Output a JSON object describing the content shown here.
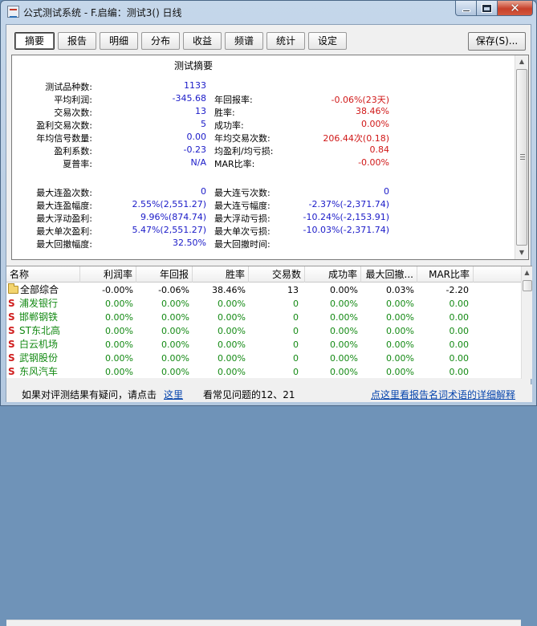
{
  "window": {
    "title": "公式测试系统 - F.启编：测试3() 日线",
    "controls": {
      "minimize": "minimize-icon",
      "maximize": "maximize-icon",
      "close": "close-icon"
    }
  },
  "tabs": [
    {
      "label": "摘要",
      "active": true
    },
    {
      "label": "报告"
    },
    {
      "label": "明细"
    },
    {
      "label": "分布"
    },
    {
      "label": "收益"
    },
    {
      "label": "频谱"
    },
    {
      "label": "统计"
    },
    {
      "label": "设定"
    }
  ],
  "save_label": "保存(S)...",
  "summary": {
    "title": "测试摘要",
    "rows": [
      {
        "l1": "测试品种数:",
        "v1": "1133",
        "c1": "blue",
        "l2": "",
        "v2": "",
        "c2": ""
      },
      {
        "l1": "平均利润:",
        "v1": "-345.68",
        "c1": "blue",
        "l2": "年回报率:",
        "v2": "-0.06%(23天)",
        "c2": "red"
      },
      {
        "l1": "交易次数:",
        "v1": "13",
        "c1": "blue",
        "l2": "胜率:",
        "v2": "38.46%",
        "c2": "red"
      },
      {
        "l1": "盈利交易次数:",
        "v1": "5",
        "c1": "blue",
        "l2": "成功率:",
        "v2": "0.00%",
        "c2": "red"
      },
      {
        "l1": "年均信号数量:",
        "v1": "0.00",
        "c1": "blue",
        "l2": "年均交易次数:",
        "v2": "206.44次(0.18)",
        "c2": "red"
      },
      {
        "l1": "盈利系数:",
        "v1": "-0.23",
        "c1": "blue",
        "l2": "均盈利/均亏损:",
        "v2": "0.84",
        "c2": "red"
      },
      {
        "l1": "夏普率:",
        "v1": "N/A",
        "c1": "blue",
        "l2": "MAR比率:",
        "v2": "-0.00%",
        "c2": "red"
      },
      {
        "l1": "",
        "v1": "",
        "c1": "",
        "l2": "",
        "v2": "",
        "c2": ""
      },
      {
        "l1": "最大连盈次数:",
        "v1": "0",
        "c1": "blue",
        "l2": "最大连亏次数:",
        "v2": "0",
        "c2": "blue"
      },
      {
        "l1": "最大连盈幅度:",
        "v1": "2.55%(2,551.27)",
        "c1": "blue",
        "l2": "最大连亏幅度:",
        "v2": "-2.37%(-2,371.74)",
        "c2": "blue"
      },
      {
        "l1": "最大浮动盈利:",
        "v1": "9.96%(874.74)",
        "c1": "blue",
        "l2": "最大浮动亏损:",
        "v2": "-10.24%(-2,153.91)",
        "c2": "blue"
      },
      {
        "l1": "最大单次盈利:",
        "v1": "5.47%(2,551.27)",
        "c1": "blue",
        "l2": "最大单次亏损:",
        "v2": "-10.03%(-2,371.74)",
        "c2": "blue"
      },
      {
        "l1": "最大回撤幅度:",
        "v1": "32.50%",
        "c1": "blue",
        "l2": "最大回撤时间:",
        "v2": "",
        "c2": "blue"
      }
    ]
  },
  "table": {
    "columns": [
      "名称",
      "利润率",
      "年回报",
      "胜率",
      "交易数",
      "成功率",
      "最大回撤...",
      "MAR比率"
    ],
    "rows": [
      {
        "name": "全部综合",
        "icon": "folder-icon",
        "values": [
          "-0.00%",
          "-0.06%",
          "38.46%",
          "13",
          "0.00%",
          "0.03%",
          "-2.20"
        ]
      },
      {
        "name": "浦发银行",
        "icon": "stock-s-icon",
        "values": [
          "0.00%",
          "0.00%",
          "0.00%",
          "0",
          "0.00%",
          "0.00%",
          "0.00"
        ]
      },
      {
        "name": "邯郸钢铁",
        "icon": "stock-s-icon",
        "values": [
          "0.00%",
          "0.00%",
          "0.00%",
          "0",
          "0.00%",
          "0.00%",
          "0.00"
        ]
      },
      {
        "name": "ST东北高",
        "icon": "stock-s-icon",
        "values": [
          "0.00%",
          "0.00%",
          "0.00%",
          "0",
          "0.00%",
          "0.00%",
          "0.00"
        ]
      },
      {
        "name": "白云机场",
        "icon": "stock-s-icon",
        "values": [
          "0.00%",
          "0.00%",
          "0.00%",
          "0",
          "0.00%",
          "0.00%",
          "0.00"
        ]
      },
      {
        "name": "武钢股份",
        "icon": "stock-s-icon",
        "values": [
          "0.00%",
          "0.00%",
          "0.00%",
          "0",
          "0.00%",
          "0.00%",
          "0.00"
        ]
      },
      {
        "name": "东风汽车",
        "icon": "stock-s-icon",
        "values": [
          "0.00%",
          "0.00%",
          "0.00%",
          "0",
          "0.00%",
          "0.00%",
          "0.00"
        ]
      }
    ]
  },
  "footer": {
    "prompt": "如果对评测结果有疑问，请点击",
    "link_here": "这里",
    "faq": "看常见问题的12、21",
    "link_glossary": "点这里看报告名词术语的详细解释"
  },
  "colors": {
    "positive_blue": "#1a1ac8",
    "negative_red": "#d01818",
    "row_green": "#148a14",
    "stock_icon_red": "#d02020"
  }
}
